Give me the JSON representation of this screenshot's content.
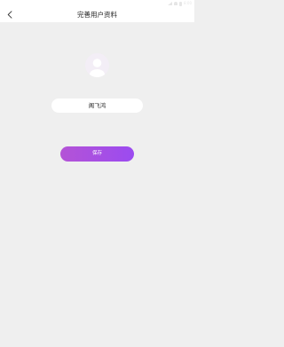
{
  "status_bar": {
    "time": "8:00",
    "icons": [
      "signal-icon",
      "wifi-icon",
      "battery-icon"
    ]
  },
  "header": {
    "back_icon": "chevron-left-icon",
    "title": "完善用户资料"
  },
  "profile": {
    "avatar_icon": "user-avatar-icon",
    "nickname": "阁飞鸿"
  },
  "actions": {
    "save_label": "保存"
  },
  "colors": {
    "background": "#efefef",
    "button_gradient_start": "#b453d6",
    "button_gradient_end": "#9b4bf0"
  }
}
